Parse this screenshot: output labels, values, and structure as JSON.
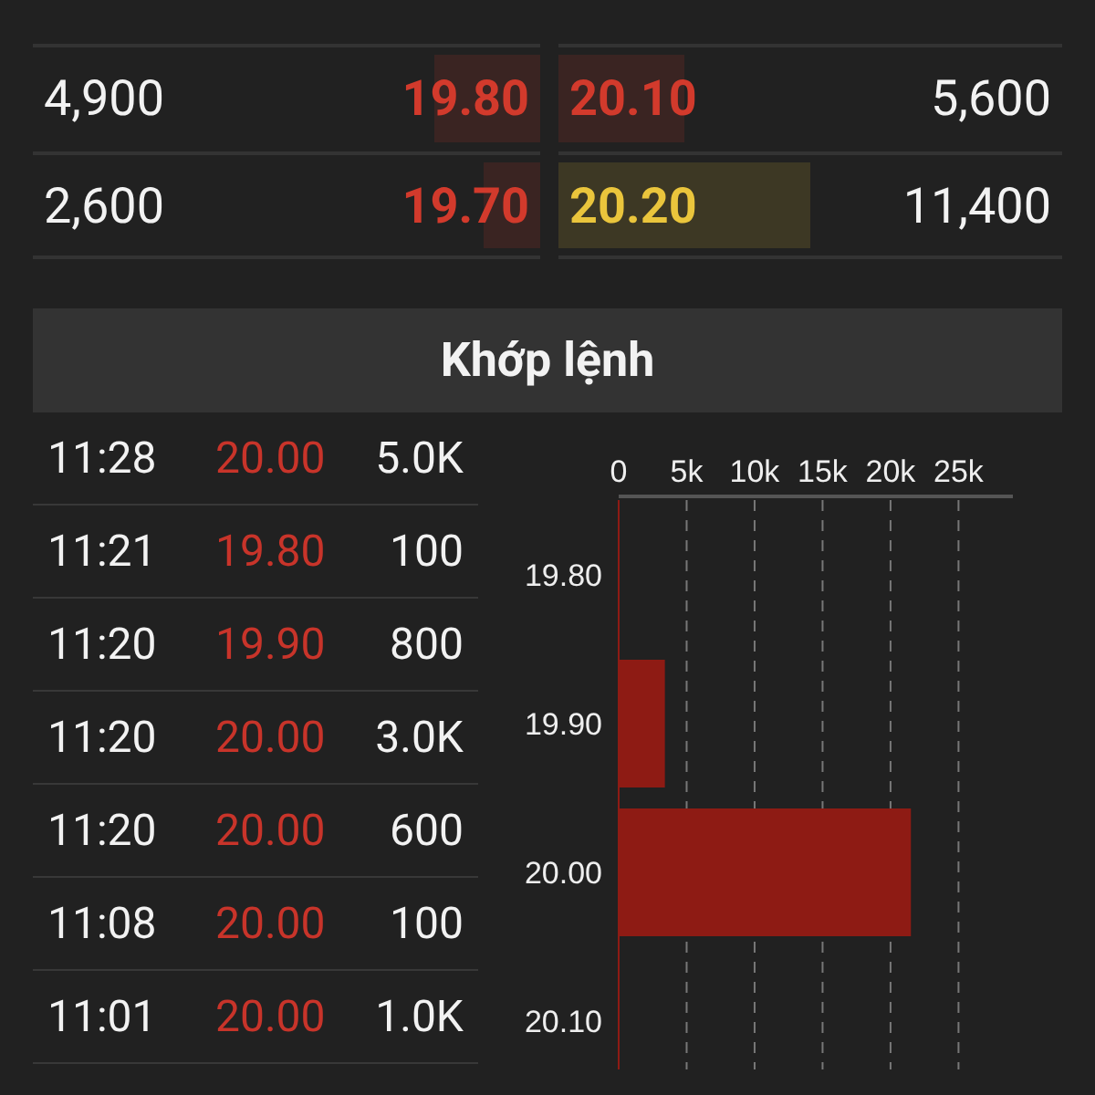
{
  "order_book": {
    "rows": [
      {
        "bid_volume": "4,900",
        "bid": {
          "price": "19.80",
          "color": "#d23a2c",
          "level": 0.21
        },
        "ask": {
          "price": "20.10",
          "color": "#d23a2c",
          "level": 0.25
        },
        "ask_volume": "5,600"
      },
      {
        "bid_volume": "2,600",
        "bid": {
          "price": "19.70",
          "color": "#d23a2c",
          "level": 0.11
        },
        "ask": {
          "price": "20.20",
          "color": "#eac53c",
          "level": 0.5
        },
        "ask_volume": "11,400"
      }
    ]
  },
  "matches": {
    "title": "Khớp lệnh",
    "trades": [
      {
        "time": "11:28",
        "price": "20.00",
        "volume": "5.0K"
      },
      {
        "time": "11:21",
        "price": "19.80",
        "volume": "100"
      },
      {
        "time": "11:20",
        "price": "19.90",
        "volume": "800"
      },
      {
        "time": "11:20",
        "price": "20.00",
        "volume": "3.0K"
      },
      {
        "time": "11:20",
        "price": "20.00",
        "volume": "600"
      },
      {
        "time": "11:08",
        "price": "20.00",
        "volume": "100"
      },
      {
        "time": "11:01",
        "price": "20.00",
        "volume": "1.0K"
      }
    ],
    "chart_data": {
      "type": "bar",
      "orientation": "horizontal",
      "categories": [
        "19.80",
        "19.90",
        "20.00",
        "20.10"
      ],
      "series": [
        {
          "color": "#8e1b14",
          "values": [
            0,
            3400,
            21500,
            0
          ]
        }
      ],
      "grid": true,
      "xlim": [
        0,
        29000
      ],
      "xticks": [
        {
          "value": 0,
          "label": "0"
        },
        {
          "value": 5000,
          "label": "5k"
        },
        {
          "value": 10000,
          "label": "10k"
        },
        {
          "value": 15000,
          "label": "15k"
        },
        {
          "value": 20000,
          "label": "20k"
        },
        {
          "value": 25000,
          "label": "25k"
        }
      ]
    }
  }
}
